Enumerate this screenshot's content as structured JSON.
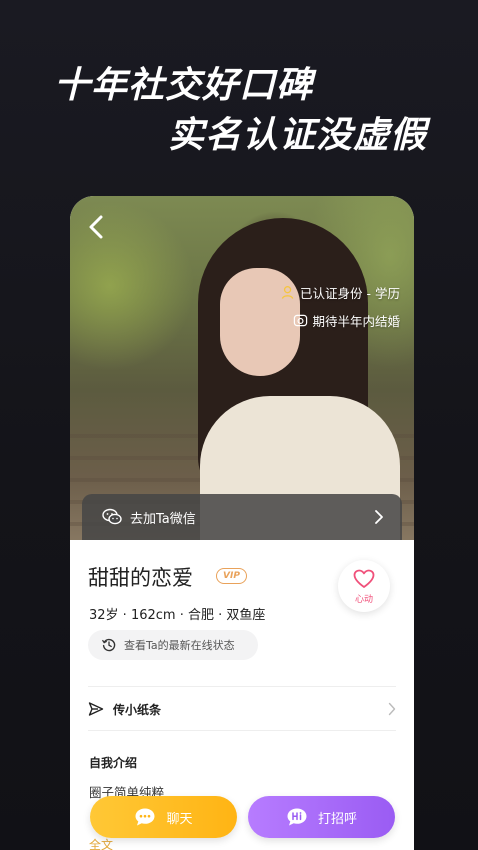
{
  "headline": {
    "line1": "十年社交好口碑",
    "line2": "实名认证没虚假"
  },
  "profile": {
    "tags": [
      "已认证身份 - 学历",
      "期待半年内结婚"
    ],
    "wechat_label": "去加Ta微信",
    "name": "甜甜的恋爱",
    "vip_badge": "VIP",
    "like_label": "心动",
    "meta": "32岁 · 162cm · 合肥 · 双鱼座",
    "status_label": "查看Ta的最新在线状态",
    "note_label": "传小纸条",
    "intro_title": "自我介绍",
    "intro_text": "圈子简单纯粹",
    "more_label": "全文"
  },
  "actions": {
    "chat_label": "聊天",
    "greet_label": "打招呼"
  },
  "colors": {
    "background": "#15151b",
    "chat_button": "#ffbe2a",
    "greet_button": "#a96cf7",
    "like": "#f0507a",
    "vip": "#e9a25a"
  },
  "icons": [
    "back-icon",
    "user-verify-icon",
    "ring-icon",
    "wechat-icon",
    "chevron-right-icon",
    "heart-icon",
    "clock-history-icon",
    "paper-plane-icon",
    "chat-bubble-icon",
    "hi-bubble-icon"
  ]
}
